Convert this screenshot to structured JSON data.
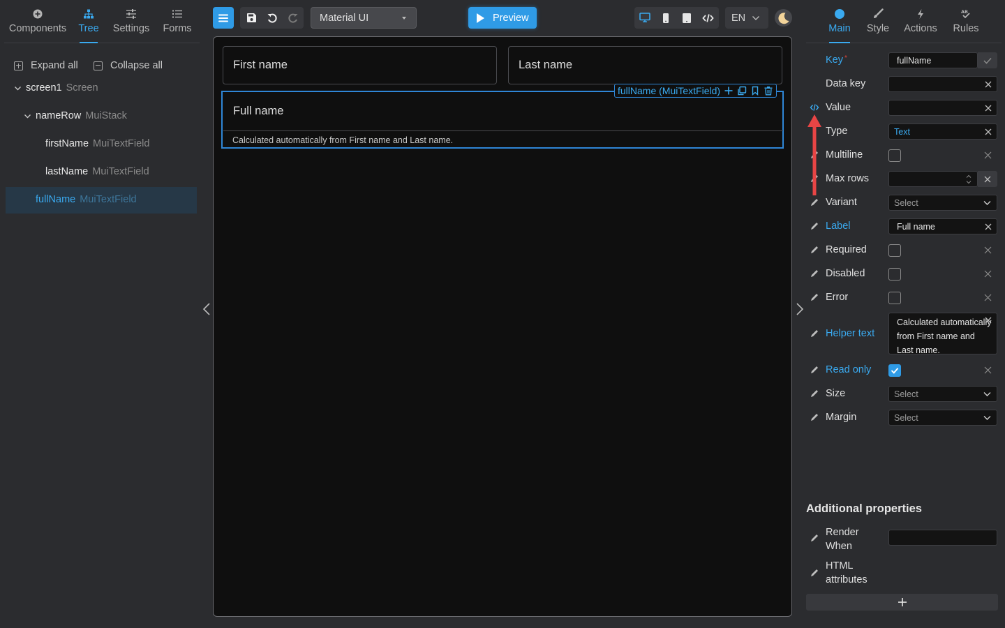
{
  "left_tabs": {
    "components": "Components",
    "tree": "Tree",
    "settings": "Settings",
    "forms": "Forms"
  },
  "tree_actions": {
    "expand_all": "Expand all",
    "collapse_all": "Collapse all"
  },
  "tree": {
    "screen": {
      "name": "screen1",
      "type": "Screen"
    },
    "row": {
      "name": "nameRow",
      "type": "MuiStack"
    },
    "first": {
      "name": "firstName",
      "type": "MuiTextField"
    },
    "last": {
      "name": "lastName",
      "type": "MuiTextField"
    },
    "full": {
      "name": "fullName",
      "type": "MuiTextField"
    }
  },
  "toolbar": {
    "library": "Material UI",
    "preview": "Preview",
    "language": "EN"
  },
  "canvas": {
    "first_name_label": "First name",
    "last_name_label": "Last name",
    "full_name_label": "Full name",
    "full_name_helper": "Calculated automatically from First name and Last name.",
    "selection_tag": "fullName (MuiTextField)"
  },
  "right_tabs": {
    "main": "Main",
    "style": "Style",
    "actions": "Actions",
    "rules": "Rules"
  },
  "props": {
    "key": {
      "label": "Key",
      "required_mark": "*",
      "value": "fullName"
    },
    "data_key": {
      "label": "Data key",
      "value": ""
    },
    "value": {
      "label": "Value",
      "value": ""
    },
    "type": {
      "label": "Type",
      "value": "Text"
    },
    "multiline": {
      "label": "Multiline",
      "checked": false
    },
    "max_rows": {
      "label": "Max rows",
      "value": ""
    },
    "variant": {
      "label": "Variant",
      "placeholder": "Select"
    },
    "label": {
      "label": "Label",
      "value": "Full name"
    },
    "required": {
      "label": "Required",
      "checked": false
    },
    "disabled": {
      "label": "Disabled",
      "checked": false
    },
    "error": {
      "label": "Error",
      "checked": false
    },
    "helper_text": {
      "label": "Helper text",
      "value_line1": "Calculated automatically",
      "value_line2": "from First name and",
      "value_line3": "Last name."
    },
    "read_only": {
      "label": "Read only",
      "checked": true
    },
    "size": {
      "label": "Size",
      "placeholder": "Select"
    },
    "margin": {
      "label": "Margin",
      "placeholder": "Select"
    }
  },
  "additional": {
    "title": "Additional properties",
    "render_when_line1": "Render",
    "render_when_line2": "When",
    "html_attrs_line1": "HTML",
    "html_attrs_line2": "attributes",
    "render_when_value": ""
  },
  "colors": {
    "accent": "#3aaaf0",
    "primary_button": "#2f9be6",
    "annotation_arrow": "#e84545",
    "canvas_bg": "#0f0f0f",
    "panel_bg": "#2b2c2f"
  }
}
